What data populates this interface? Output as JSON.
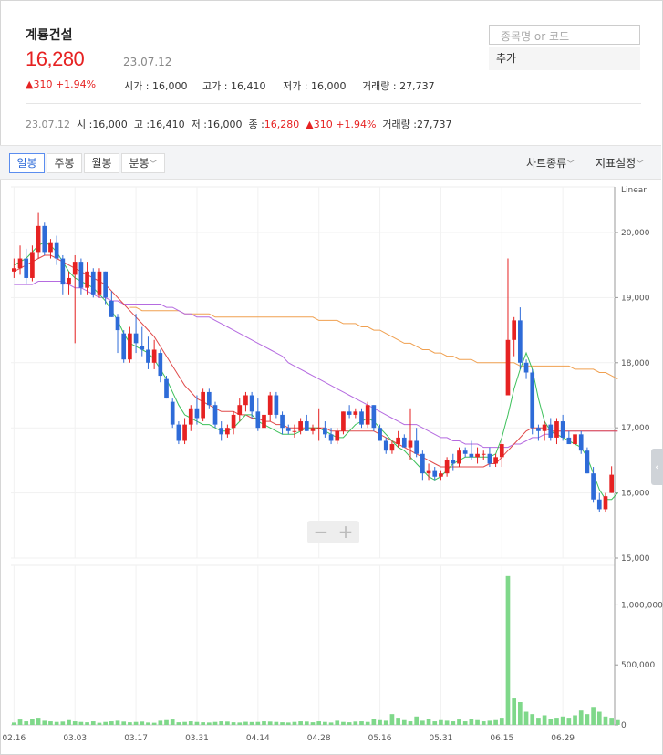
{
  "stock": {
    "name": "계룡건설",
    "price": "16,280",
    "date": "23.07.12",
    "change": "▲310 +1.94%",
    "open_label": "시가",
    "open": "16,000",
    "high_label": "고가",
    "high": "16,410",
    "low_label": "저가",
    "low": "16,000",
    "volume_label": "거래량",
    "volume": "27,737"
  },
  "search": {
    "placeholder": "종목명 or 코드",
    "add_label": "추가"
  },
  "summary": {
    "date": "23.07.12",
    "open_label": "시 :",
    "open": "16,000",
    "high_label": "고 :",
    "high": "16,410",
    "low_label": "저 :",
    "low": "16,000",
    "close_label": "종 :",
    "close": "16,280",
    "change": "▲310 +1.94%",
    "volume_label": "거래량 :",
    "volume": "27,737"
  },
  "toolbar": {
    "tabs": [
      "일봉",
      "주봉",
      "월봉",
      "분봉"
    ],
    "active_tab": "일봉",
    "chart_type": "차트종류",
    "indicator": "지표설정"
  },
  "colors": {
    "up": "#e62222",
    "down": "#2e6bd8",
    "ma5": "#3cc05a",
    "ma20": "#e04a4a",
    "ma60": "#b56be0",
    "ma120": "#f0a050",
    "volume": "#7fd88a"
  },
  "chart_data": {
    "type": "candlestick",
    "scale_label": "Linear",
    "ylim": [
      15000,
      20700
    ],
    "yticks": [
      "20,000",
      "19,000",
      "18,000",
      "17,000",
      "16,000",
      "15,000"
    ],
    "ytick_values": [
      20000,
      19000,
      18000,
      17000,
      16000,
      15000
    ],
    "volume_ylim": [
      0,
      1330000
    ],
    "volume_ticks": [
      "1,000,000",
      "500,000",
      "0"
    ],
    "volume_tick_values": [
      1000000,
      500000,
      0
    ],
    "x_labels": [
      "02.16",
      "03.03",
      "03.17",
      "03.31",
      "04.14",
      "04.28",
      "05.16",
      "05.31",
      "06.15",
      "06.29"
    ],
    "x_label_index": [
      0,
      10,
      20,
      30,
      40,
      50,
      60,
      70,
      80,
      90
    ],
    "ohlc": [
      [
        19400,
        19600,
        19300,
        19450
      ],
      [
        19450,
        19800,
        19350,
        19600
      ],
      [
        19600,
        19750,
        19200,
        19300
      ],
      [
        19300,
        19800,
        19250,
        19700
      ],
      [
        19700,
        20300,
        19600,
        20100
      ],
      [
        20100,
        20150,
        19650,
        19700
      ],
      [
        19700,
        19900,
        19600,
        19850
      ],
      [
        19850,
        19950,
        19500,
        19600
      ],
      [
        19600,
        19650,
        19050,
        19200
      ],
      [
        19200,
        19400,
        19050,
        19300
      ],
      [
        19350,
        19650,
        18300,
        19550
      ],
      [
        19550,
        19600,
        19050,
        19150
      ],
      [
        19150,
        19550,
        19050,
        19400
      ],
      [
        19400,
        19450,
        19000,
        19050
      ],
      [
        19050,
        19450,
        19000,
        19400
      ],
      [
        19400,
        19400,
        18900,
        19000
      ],
      [
        18950,
        19100,
        18700,
        18700
      ],
      [
        18700,
        18750,
        18150,
        18500
      ],
      [
        18450,
        18500,
        18000,
        18050
      ],
      [
        18050,
        18550,
        18000,
        18450
      ],
      [
        18450,
        18750,
        18150,
        18300
      ],
      [
        18250,
        18550,
        18100,
        18200
      ],
      [
        18200,
        18400,
        17900,
        18000
      ],
      [
        18000,
        18350,
        17900,
        18200
      ],
      [
        18150,
        18200,
        17700,
        17800
      ],
      [
        17750,
        17800,
        17450,
        17450
      ],
      [
        17400,
        17450,
        17000,
        17050
      ],
      [
        17050,
        17100,
        16750,
        16800
      ],
      [
        16800,
        17150,
        16750,
        17050
      ],
      [
        17050,
        17350,
        16950,
        17300
      ],
      [
        17300,
        17500,
        17050,
        17150
      ],
      [
        17150,
        17600,
        17100,
        17550
      ],
      [
        17550,
        17600,
        17300,
        17350
      ],
      [
        17350,
        17400,
        17000,
        17050
      ],
      [
        17000,
        17100,
        16800,
        16900
      ],
      [
        16900,
        17050,
        16850,
        17000
      ],
      [
        17000,
        17250,
        16900,
        17200
      ],
      [
        17200,
        17450,
        17100,
        17350
      ],
      [
        17350,
        17550,
        17250,
        17500
      ],
      [
        17500,
        17550,
        17150,
        17250
      ],
      [
        17250,
        17450,
        16950,
        17000
      ],
      [
        17000,
        17300,
        16700,
        17200
      ],
      [
        17200,
        17550,
        17100,
        17500
      ],
      [
        17500,
        17550,
        17150,
        17200
      ],
      [
        17200,
        17250,
        16900,
        17000
      ],
      [
        17000,
        17050,
        16900,
        16950
      ],
      [
        16950,
        17050,
        16850,
        16950
      ],
      [
        16950,
        17150,
        16900,
        17100
      ],
      [
        17100,
        17200,
        16950,
        16950
      ],
      [
        16950,
        17050,
        16900,
        17000
      ],
      [
        17000,
        17300,
        16800,
        17000
      ],
      [
        17000,
        17100,
        16850,
        16900
      ],
      [
        16900,
        17000,
        16750,
        16800
      ],
      [
        16800,
        17000,
        16750,
        16950
      ],
      [
        16950,
        17250,
        16900,
        17250
      ],
      [
        17250,
        17350,
        17150,
        17200
      ],
      [
        17200,
        17300,
        17150,
        17250
      ],
      [
        17250,
        17300,
        17000,
        17050
      ],
      [
        17050,
        17400,
        17000,
        17350
      ],
      [
        17350,
        17350,
        16950,
        17000
      ],
      [
        17000,
        17050,
        16800,
        16800
      ],
      [
        16800,
        16850,
        16600,
        16650
      ],
      [
        16650,
        16800,
        16600,
        16750
      ],
      [
        16750,
        16950,
        16700,
        16850
      ],
      [
        16850,
        16900,
        16700,
        16700
      ],
      [
        16700,
        17300,
        16500,
        16800
      ],
      [
        16800,
        17000,
        16550,
        16600
      ],
      [
        16600,
        16650,
        16200,
        16300
      ],
      [
        16300,
        16450,
        16200,
        16350
      ],
      [
        16350,
        16400,
        16200,
        16250
      ],
      [
        16250,
        16350,
        16200,
        16300
      ],
      [
        16300,
        16550,
        16250,
        16500
      ],
      [
        16500,
        16600,
        16350,
        16450
      ],
      [
        16450,
        16700,
        16400,
        16650
      ],
      [
        16650,
        16700,
        16550,
        16600
      ],
      [
        16600,
        16800,
        16500,
        16550
      ],
      [
        16550,
        16700,
        16450,
        16600
      ],
      [
        16600,
        16650,
        16500,
        16600
      ],
      [
        16600,
        16700,
        16400,
        16450
      ],
      [
        16450,
        16600,
        16400,
        16550
      ],
      [
        16550,
        16800,
        16400,
        16750
      ],
      [
        17500,
        19600,
        17600,
        18350
      ],
      [
        18350,
        18700,
        18100,
        18650
      ],
      [
        18650,
        18850,
        17900,
        18000
      ],
      [
        18000,
        18050,
        17750,
        17850
      ],
      [
        17850,
        17900,
        16900,
        17000
      ],
      [
        17000,
        17050,
        16800,
        16950
      ],
      [
        16950,
        17100,
        16800,
        17050
      ],
      [
        17050,
        17150,
        16800,
        16850
      ],
      [
        16850,
        17150,
        16750,
        17100
      ],
      [
        17100,
        17200,
        16800,
        16850
      ],
      [
        16850,
        16950,
        16750,
        16750
      ],
      [
        16750,
        16950,
        16700,
        16900
      ],
      [
        16900,
        16950,
        16600,
        16650
      ],
      [
        16650,
        16700,
        16300,
        16300
      ],
      [
        16300,
        16400,
        15850,
        15900
      ],
      [
        15900,
        16000,
        15700,
        15750
      ],
      [
        15750,
        16000,
        15700,
        15950
      ],
      [
        16000,
        16410,
        16000,
        16280
      ]
    ],
    "volume": [
      20000,
      45000,
      30000,
      50000,
      60000,
      35000,
      30000,
      25000,
      28000,
      40000,
      30000,
      25000,
      22000,
      30000,
      18000,
      25000,
      30000,
      35000,
      28000,
      22000,
      25000,
      28000,
      20000,
      18000,
      35000,
      40000,
      45000,
      22000,
      25000,
      30000,
      25000,
      22000,
      20000,
      25000,
      30000,
      28000,
      22000,
      20000,
      26000,
      24000,
      25000,
      30000,
      28000,
      25000,
      22000,
      20000,
      25000,
      30000,
      28000,
      22000,
      30000,
      25000,
      20000,
      35000,
      25000,
      22000,
      28000,
      30000,
      25000,
      50000,
      40000,
      35000,
      90000,
      60000,
      40000,
      30000,
      70000,
      35000,
      50000,
      30000,
      40000,
      35000,
      30000,
      45000,
      30000,
      50000,
      40000,
      30000,
      35000,
      40000,
      60000,
      1240000,
      220000,
      190000,
      110000,
      90000,
      60000,
      80000,
      50000,
      60000,
      70000,
      60000,
      80000,
      120000,
      90000,
      150000,
      110000,
      70000,
      60000,
      40000
    ],
    "ma5": [
      19500,
      19550,
      19600,
      19700,
      19800,
      19850,
      19800,
      19700,
      19550,
      19400,
      19300,
      19250,
      19200,
      19150,
      19050,
      18950,
      18800,
      18650,
      18450,
      18300,
      18250,
      18200,
      18150,
      18050,
      17900,
      17750,
      17550,
      17350,
      17200,
      17150,
      17100,
      17050,
      17050,
      17000,
      16950,
      16950,
      17000,
      17100,
      17200,
      17200,
      17100,
      17050,
      17000,
      16950,
      16900,
      16900,
      16900,
      16950,
      17000,
      17000,
      17000,
      16950,
      16900,
      16850,
      16850,
      16950,
      17050,
      17100,
      17150,
      17100,
      17000,
      16900,
      16800,
      16700,
      16650,
      16550,
      16450,
      16350,
      16250,
      16200,
      16250,
      16350,
      16450,
      16500,
      16550,
      16550,
      16550,
      16550,
      16550,
      16600,
      16850,
      17200,
      17600,
      17900,
      18150,
      17900,
      17450,
      17100,
      16950,
      16900,
      16850,
      16800,
      16750,
      16700,
      16550,
      16300,
      16050,
      15900,
      15900,
      16000
    ],
    "ma20": [
      19400,
      19450,
      19500,
      19550,
      19600,
      19650,
      19650,
      19600,
      19550,
      19500,
      19450,
      19400,
      19350,
      19300,
      19250,
      19200,
      19100,
      19000,
      18900,
      18800,
      18700,
      18600,
      18500,
      18400,
      18250,
      18100,
      17950,
      17800,
      17650,
      17550,
      17450,
      17400,
      17350,
      17300,
      17250,
      17250,
      17250,
      17200,
      17200,
      17150,
      17150,
      17100,
      17100,
      17050,
      17050,
      17000,
      17000,
      17000,
      17000,
      17000,
      17000,
      17000,
      16950,
      16950,
      16950,
      16950,
      16950,
      16950,
      16950,
      16950,
      16900,
      16850,
      16800,
      16750,
      16700,
      16650,
      16600,
      16550,
      16500,
      16450,
      16400,
      16400,
      16400,
      16400,
      16400,
      16400,
      16400,
      16400,
      16450,
      16450,
      16550,
      16650,
      16750,
      16850,
      16950,
      17000,
      17000,
      17000,
      16950,
      16950,
      16950,
      16950,
      16950,
      16950,
      16950,
      16950,
      16950,
      16950,
      16950,
      16950
    ],
    "ma60": [
      19200,
      19200,
      19200,
      19200,
      19250,
      19250,
      19250,
      19250,
      19250,
      19200,
      19150,
      19150,
      19100,
      19050,
      19000,
      19000,
      18950,
      18950,
      18900,
      18900,
      18900,
      18900,
      18900,
      18900,
      18900,
      18850,
      18850,
      18800,
      18750,
      18750,
      18700,
      18700,
      18700,
      18650,
      18600,
      18550,
      18500,
      18450,
      18400,
      18350,
      18300,
      18250,
      18200,
      18150,
      18100,
      18000,
      17950,
      17900,
      17850,
      17800,
      17750,
      17700,
      17650,
      17600,
      17550,
      17500,
      17450,
      17400,
      17350,
      17300,
      17250,
      17200,
      17150,
      17100,
      17050,
      17050,
      17050,
      17000,
      16950,
      16900,
      16850,
      16850,
      16800,
      16800,
      16750,
      16750,
      16750,
      16700,
      16700,
      16700,
      16700,
      16700,
      16750,
      16750,
      16800,
      16850,
      16850,
      16900,
      16900,
      16950,
      16950,
      16950,
      16950,
      16950,
      16950,
      16950,
      16950,
      16950,
      16950,
      16950
    ],
    "ma120": [
      null,
      null,
      null,
      null,
      null,
      null,
      null,
      null,
      null,
      null,
      null,
      null,
      null,
      null,
      null,
      null,
      null,
      null,
      null,
      18850,
      18850,
      18800,
      18800,
      18800,
      18800,
      18800,
      18800,
      18800,
      18750,
      18750,
      18750,
      18750,
      18750,
      18700,
      18700,
      18700,
      18700,
      18700,
      18700,
      18700,
      18700,
      18700,
      18700,
      18700,
      18700,
      18700,
      18700,
      18700,
      18700,
      18700,
      18650,
      18650,
      18650,
      18650,
      18600,
      18600,
      18600,
      18550,
      18550,
      18500,
      18500,
      18450,
      18400,
      18350,
      18300,
      18300,
      18250,
      18200,
      18200,
      18150,
      18150,
      18100,
      18100,
      18050,
      18050,
      18050,
      18000,
      18000,
      18000,
      18000,
      18000,
      18000,
      18000,
      17950,
      17950,
      17950,
      17950,
      17950,
      17950,
      17950,
      17950,
      17950,
      17900,
      17900,
      17900,
      17900,
      17850,
      17850,
      17800,
      17750
    ]
  }
}
